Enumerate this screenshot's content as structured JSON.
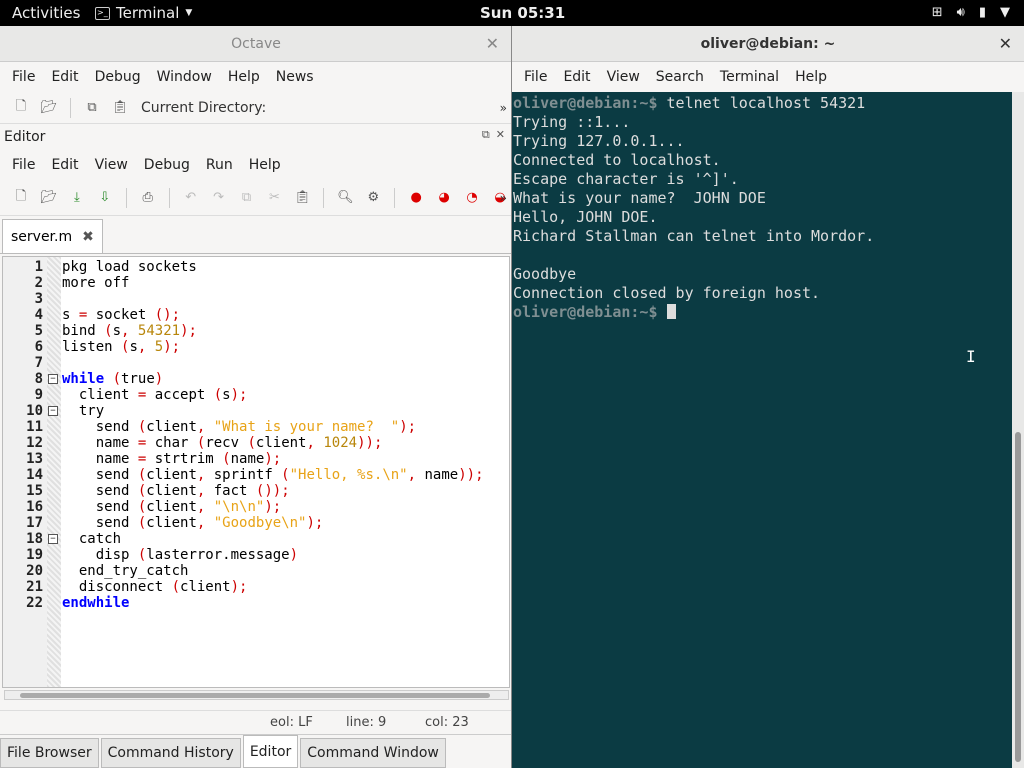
{
  "topbar": {
    "activities": "Activities",
    "app": "Terminal",
    "clock": "Sun 05:31"
  },
  "octave": {
    "title": "Octave",
    "menu": [
      "File",
      "Edit",
      "Debug",
      "Window",
      "Help",
      "News"
    ],
    "current_dir_label": "Current Directory:",
    "editor_label": "Editor",
    "editor_menu": [
      "File",
      "Edit",
      "View",
      "Debug",
      "Run",
      "Help"
    ],
    "file_tab": "server.m",
    "status": {
      "eol": "eol: LF",
      "line": "line: 9",
      "col": "col: 23"
    },
    "bottom_tabs": [
      "File Browser",
      "Command History",
      "Editor",
      "Command Window"
    ],
    "active_bottom_tab": "Editor"
  },
  "code_lines": [
    {
      "n": "1",
      "t": "pkg load sockets"
    },
    {
      "n": "2",
      "t": "more off"
    },
    {
      "n": "3",
      "t": ""
    },
    {
      "n": "4",
      "t": "s = socket ();"
    },
    {
      "n": "5",
      "t": "bind (s, 54321);"
    },
    {
      "n": "6",
      "t": "listen (s, 5);"
    },
    {
      "n": "7",
      "t": ""
    },
    {
      "n": "8",
      "t": "while (true)"
    },
    {
      "n": "9",
      "t": "  client = accept (s);"
    },
    {
      "n": "10",
      "t": "  try"
    },
    {
      "n": "11",
      "t": "    send (client, \"What is your name?  \");"
    },
    {
      "n": "12",
      "t": "    name = char (recv (client, 1024));"
    },
    {
      "n": "13",
      "t": "    name = strtrim (name);"
    },
    {
      "n": "14",
      "t": "    send (client, sprintf (\"Hello, %s.\\n\", name));"
    },
    {
      "n": "15",
      "t": "    send (client, fact ());"
    },
    {
      "n": "16",
      "t": "    send (client, \"\\n\\n\");"
    },
    {
      "n": "17",
      "t": "    send (client, \"Goodbye\\n\");"
    },
    {
      "n": "18",
      "t": "  catch"
    },
    {
      "n": "19",
      "t": "    disp (lasterror.message)"
    },
    {
      "n": "20",
      "t": "  end_try_catch"
    },
    {
      "n": "21",
      "t": "  disconnect (client);"
    },
    {
      "n": "22",
      "t": "endwhile"
    }
  ],
  "terminal": {
    "title": "oliver@debian: ~",
    "menu": [
      "File",
      "Edit",
      "View",
      "Search",
      "Terminal",
      "Help"
    ],
    "prompt": "oliver@debian:~$",
    "command": " telnet localhost 54321",
    "output": [
      "Trying ::1...",
      "Trying 127.0.0.1...",
      "Connected to localhost.",
      "Escape character is '^]'.",
      "What is your name?  JOHN DOE",
      "Hello, JOHN DOE.",
      "Richard Stallman can telnet into Mordor.",
      "",
      "Goodbye",
      "Connection closed by foreign host."
    ]
  }
}
